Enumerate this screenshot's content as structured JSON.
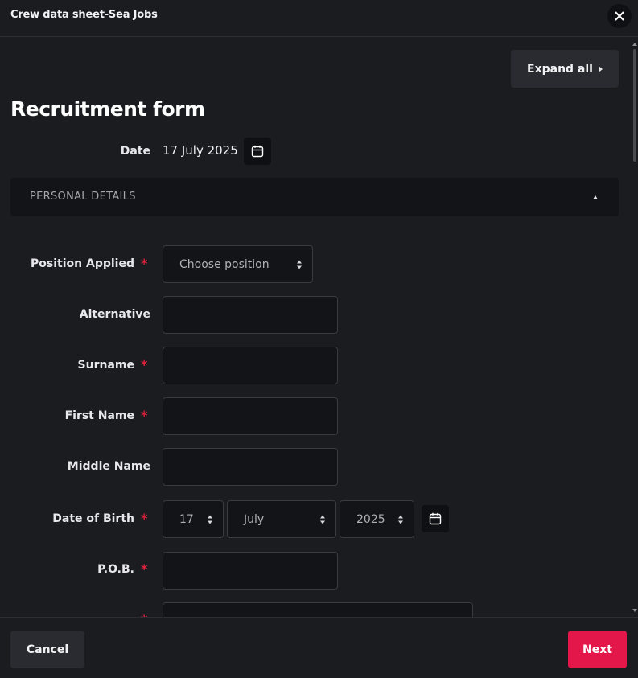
{
  "window": {
    "title": "Crew data sheet-Sea Jobs"
  },
  "toolbar": {
    "expand_label": "Expand all"
  },
  "page": {
    "title": "Recruitment form"
  },
  "date_field": {
    "label": "Date",
    "value": "17 July 2025"
  },
  "section": {
    "title": "PERSONAL DETAILS",
    "expanded": true
  },
  "fields": {
    "position_applied": {
      "label": "Position Applied",
      "required": "*",
      "placeholder": "Choose position"
    },
    "alternative": {
      "label": "Alternative",
      "value": ""
    },
    "surname": {
      "label": "Surname",
      "required": "*",
      "value": ""
    },
    "first_name": {
      "label": "First Name",
      "required": "*",
      "value": ""
    },
    "middle_name": {
      "label": "Middle Name",
      "value": ""
    },
    "date_of_birth": {
      "label": "Date of Birth",
      "required": "*",
      "day": "17",
      "month": "July",
      "year": "2025"
    },
    "pob": {
      "label": "P.O.B.",
      "required": "*",
      "value": ""
    },
    "next_field": {
      "required": "*"
    }
  },
  "footer": {
    "cancel_label": "Cancel",
    "next_label": "Next"
  },
  "colors": {
    "accent": "#e3174a",
    "required": "#e0223d",
    "background": "#1b1c20",
    "field_background": "#131417"
  },
  "icons": [
    "close-icon",
    "chevron-right-icon",
    "calendar-icon",
    "chevron-up-icon",
    "select-arrows-icon"
  ]
}
